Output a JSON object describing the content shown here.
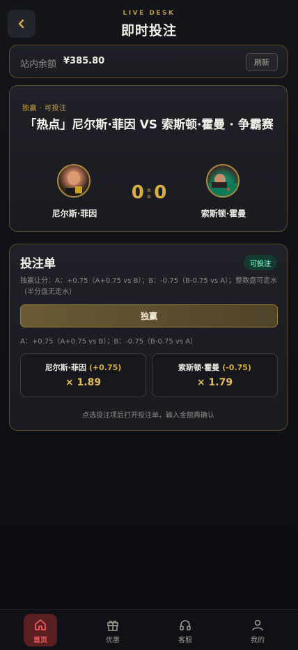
{
  "header": {
    "kicker": "LIVE DESK",
    "title": "即时投注"
  },
  "balance": {
    "label": "站内余额",
    "value": "¥385.80",
    "refresh_label": "刷新"
  },
  "match": {
    "status": "独赢 · 可投注",
    "title": "「热点」尼尔斯·菲因 VS 索斯顿·霍曼 · 争霸赛",
    "score_a": "0",
    "score_sep": ":",
    "score_b": "0",
    "player_a": "尼尔斯·菲因",
    "player_b": "索斯顿·霍曼"
  },
  "bet_slip": {
    "title": "投注单",
    "badge": "可投注",
    "description": "独赢让分：A：+0.75（A+0.75 vs B）；B：-0.75（B-0.75 vs A）；整数盘可走水（半分盘无走水）",
    "mode_button": "独赢",
    "handicap_note": "A：+0.75（A+0.75 vs B）；B：-0.75（B-0.75 vs A）",
    "options": [
      {
        "name": "尼尔斯·菲因",
        "handicap": "(+0.75)",
        "odds": "× 1.89"
      },
      {
        "name": "索斯顿·霍曼",
        "handicap": "(-0.75)",
        "odds": "× 1.79"
      }
    ],
    "hint": "点选投注项后打开投注单，输入金额再确认"
  },
  "nav": {
    "items": [
      {
        "label": "首页",
        "icon": "home-icon",
        "active": true
      },
      {
        "label": "优惠",
        "icon": "gift-icon",
        "active": false
      },
      {
        "label": "客服",
        "icon": "headset-icon",
        "active": false
      },
      {
        "label": "我的",
        "icon": "user-icon",
        "active": false
      }
    ]
  },
  "colors": {
    "accent_gold": "#d8ae43",
    "active_red": "#f05b5b",
    "badge_green": "#5fd2a6"
  }
}
